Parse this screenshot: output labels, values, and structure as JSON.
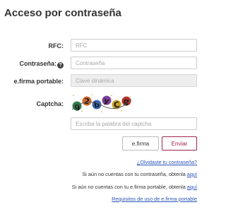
{
  "header": {
    "title": "Acceso por contraseña"
  },
  "form": {
    "rfc": {
      "label": "RFC:",
      "placeholder": "RFC"
    },
    "password": {
      "label": "Contraseña:",
      "placeholder": "Contraseña",
      "info_icon": "info-icon"
    },
    "efirma": {
      "label": "e.firma portable:",
      "placeholder": "Clave dinámica"
    },
    "captcha": {
      "label": "Captcha:",
      "text": "g2byCg",
      "placeholder": "Escriba la palabra del captcha"
    }
  },
  "buttons": {
    "efirma_label": "e.firma",
    "enviar_label": "Enviar"
  },
  "links": {
    "forgot": "¿Olvidaste tu contraseña?",
    "no_password_text": "Si aún no cuentas con tu contraseña, obtenla ",
    "no_password_link": "aquí",
    "no_efirma_text": "Si aún no cuentas con tu e.firma portable, obtenla ",
    "no_efirma_link": "aquí",
    "requirements": "Requisitos de uso de e.firma portable"
  },
  "colors": {
    "accent": "#9d2449",
    "link": "#2a55b8",
    "text": "#333333"
  }
}
